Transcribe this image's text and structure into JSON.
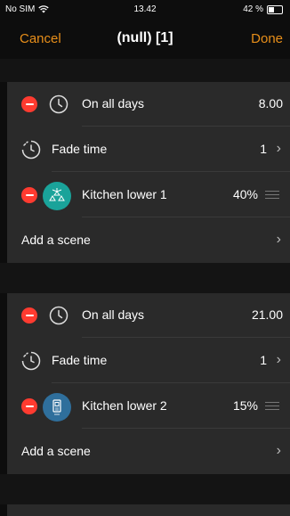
{
  "status": {
    "carrier": "No SIM",
    "time": "13.42",
    "battery": "42 %",
    "battery_level": 0.42
  },
  "nav": {
    "cancel": "Cancel",
    "title": "(null) [1]",
    "done": "Done"
  },
  "entries": [
    {
      "schedule_label": "On all days",
      "schedule_value": "8.00",
      "fade_label": "Fade time",
      "fade_value": "1",
      "scene_name": "Kitchen lower 1",
      "scene_level": "40%",
      "scene_icon": "pendant-lights-icon",
      "add_scene": "Add a scene"
    },
    {
      "schedule_label": "On all days",
      "schedule_value": "21.00",
      "fade_label": "Fade time",
      "fade_value": "1",
      "scene_name": "Kitchen lower 2",
      "scene_level": "15%",
      "scene_icon": "wall-switch-icon",
      "add_scene": "Add a scene"
    }
  ],
  "colors": {
    "accent": "#e88f1a",
    "destructive": "#ff3b30",
    "teal": "#1aa39a",
    "blue": "#2f6f9c"
  }
}
